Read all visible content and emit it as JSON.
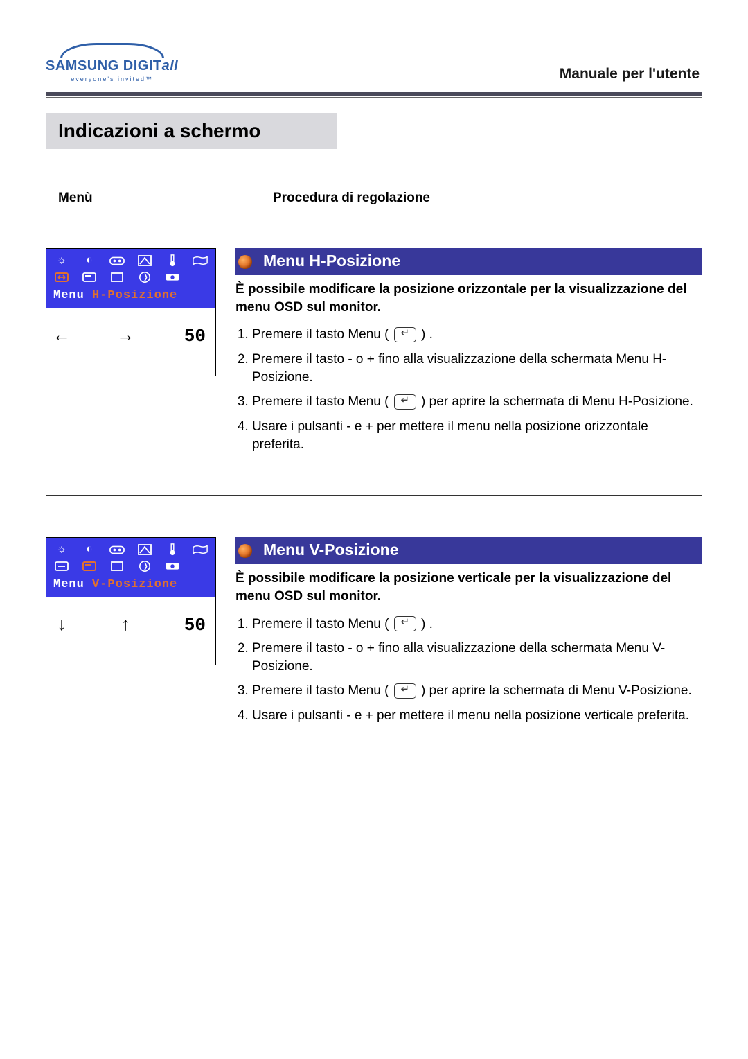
{
  "header": {
    "brand_main": "SAMSUNG DIGIT",
    "brand_suffix": "all",
    "brand_tag": "everyone's invited™",
    "manual_title": "Manuale per l'utente"
  },
  "page_title": "Indicazioni a schermo",
  "columns": {
    "left": "Menù",
    "right": "Procedura di regolazione"
  },
  "sections": [
    {
      "osd_label_prefix": "Menu ",
      "osd_label_hl": "H-Posizione",
      "osd_value": "50",
      "arrow_left": "←",
      "arrow_right": "→",
      "title": "Menu H-Posizione",
      "description": "È possibile modificare la posizione orizzontale per la visualizzazione del menu OSD sul monitor.",
      "steps": [
        {
          "pre": "Premere il tasto Menu ( ",
          "btn": true,
          "post": " ) ."
        },
        {
          "pre": "Premere il tasto - o + fino alla visualizzazione della schermata Menu H-Posizione."
        },
        {
          "pre": "Premere il tasto Menu ( ",
          "btn": true,
          "post": " ) per aprire la schermata di Menu H-Posizione."
        },
        {
          "pre": "Usare i pulsanti - e + per mettere il menu nella posizione orizzontale preferita."
        }
      ]
    },
    {
      "osd_label_prefix": "Menu ",
      "osd_label_hl": "V-Posizione",
      "osd_value": "50",
      "arrow_left": "↓",
      "arrow_right": "↑",
      "title": "Menu V-Posizione",
      "description": "È possibile modificare la posizione verticale per la visualizzazione del menu OSD sul monitor.",
      "steps": [
        {
          "pre": "Premere il tasto Menu ( ",
          "btn": true,
          "post": " ) ."
        },
        {
          "pre": "Premere il tasto - o + fino alla visualizzazione della schermata Menu V-Posizione."
        },
        {
          "pre": "Premere il tasto Menu ( ",
          "btn": true,
          "post": " ) per aprire la schermata di Menu V-Posizione."
        },
        {
          "pre": "Usare i pulsanti - e + per mettere il menu nella posizione verticale preferita."
        }
      ]
    }
  ]
}
